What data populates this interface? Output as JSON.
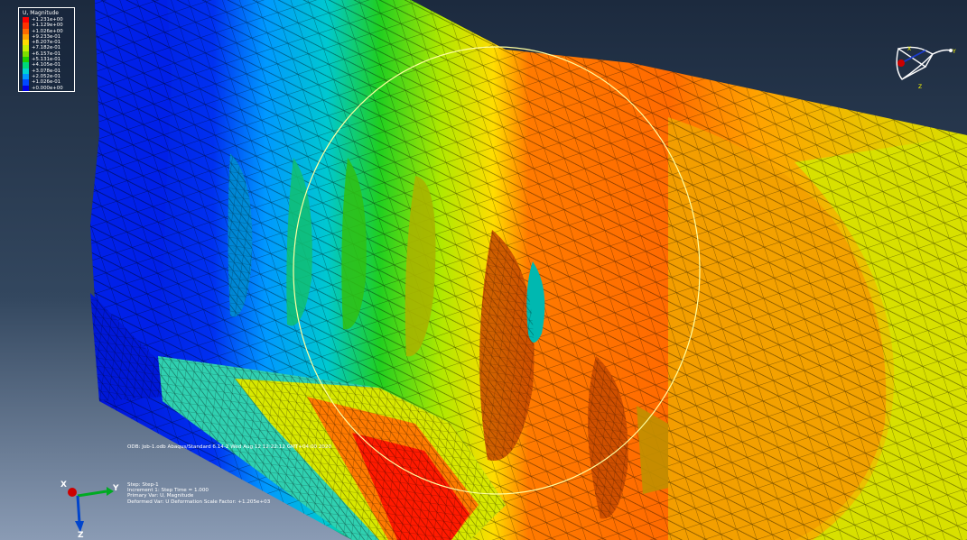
{
  "legend": {
    "title": "U, Magnitude",
    "entries": [
      {
        "label": "+1.231e+00",
        "color": "#ff0000"
      },
      {
        "label": "+1.129e+00",
        "color": "#ff3300"
      },
      {
        "label": "+1.026e+00",
        "color": "#ff6a00"
      },
      {
        "label": "+9.233e-01",
        "color": "#ffa200"
      },
      {
        "label": "+8.207e-01",
        "color": "#ffdd00"
      },
      {
        "label": "+7.182e-01",
        "color": "#c8f000"
      },
      {
        "label": "+6.157e-01",
        "color": "#7ddd00"
      },
      {
        "label": "+5.131e-01",
        "color": "#1ecf00"
      },
      {
        "label": "+4.105e-01",
        "color": "#00d87a"
      },
      {
        "label": "+3.078e-01",
        "color": "#00d4d0"
      },
      {
        "label": "+2.052e-01",
        "color": "#0098ff"
      },
      {
        "label": "+1.026e-01",
        "color": "#0048ff"
      },
      {
        "label": "+0.000e+00",
        "color": "#0000e6"
      }
    ]
  },
  "odb_line": "ODB: Job-1.odb    Abaqus/Standard 6.14-2    Wed Aug 12 12:22:12 GMT+04:00 2020",
  "step_info": [
    "Step: Step-1",
    "Increment      1: Step Time =    1.000",
    "Primary Var: U, Magnitude",
    "Deformed Var: U   Deformation Scale Factor: +1.205e+03"
  ],
  "triad": {
    "x": "X",
    "y": "Y",
    "z": "Z"
  },
  "view_cube": {
    "x": "X",
    "y": "Y",
    "z": "Z"
  },
  "colors": {
    "bg_top": "#1c2a3e",
    "bg_bottom": "#8a9bb4",
    "triad_x": "#cc0000",
    "triad_y": "#00aa22",
    "triad_z": "#0044cc"
  }
}
